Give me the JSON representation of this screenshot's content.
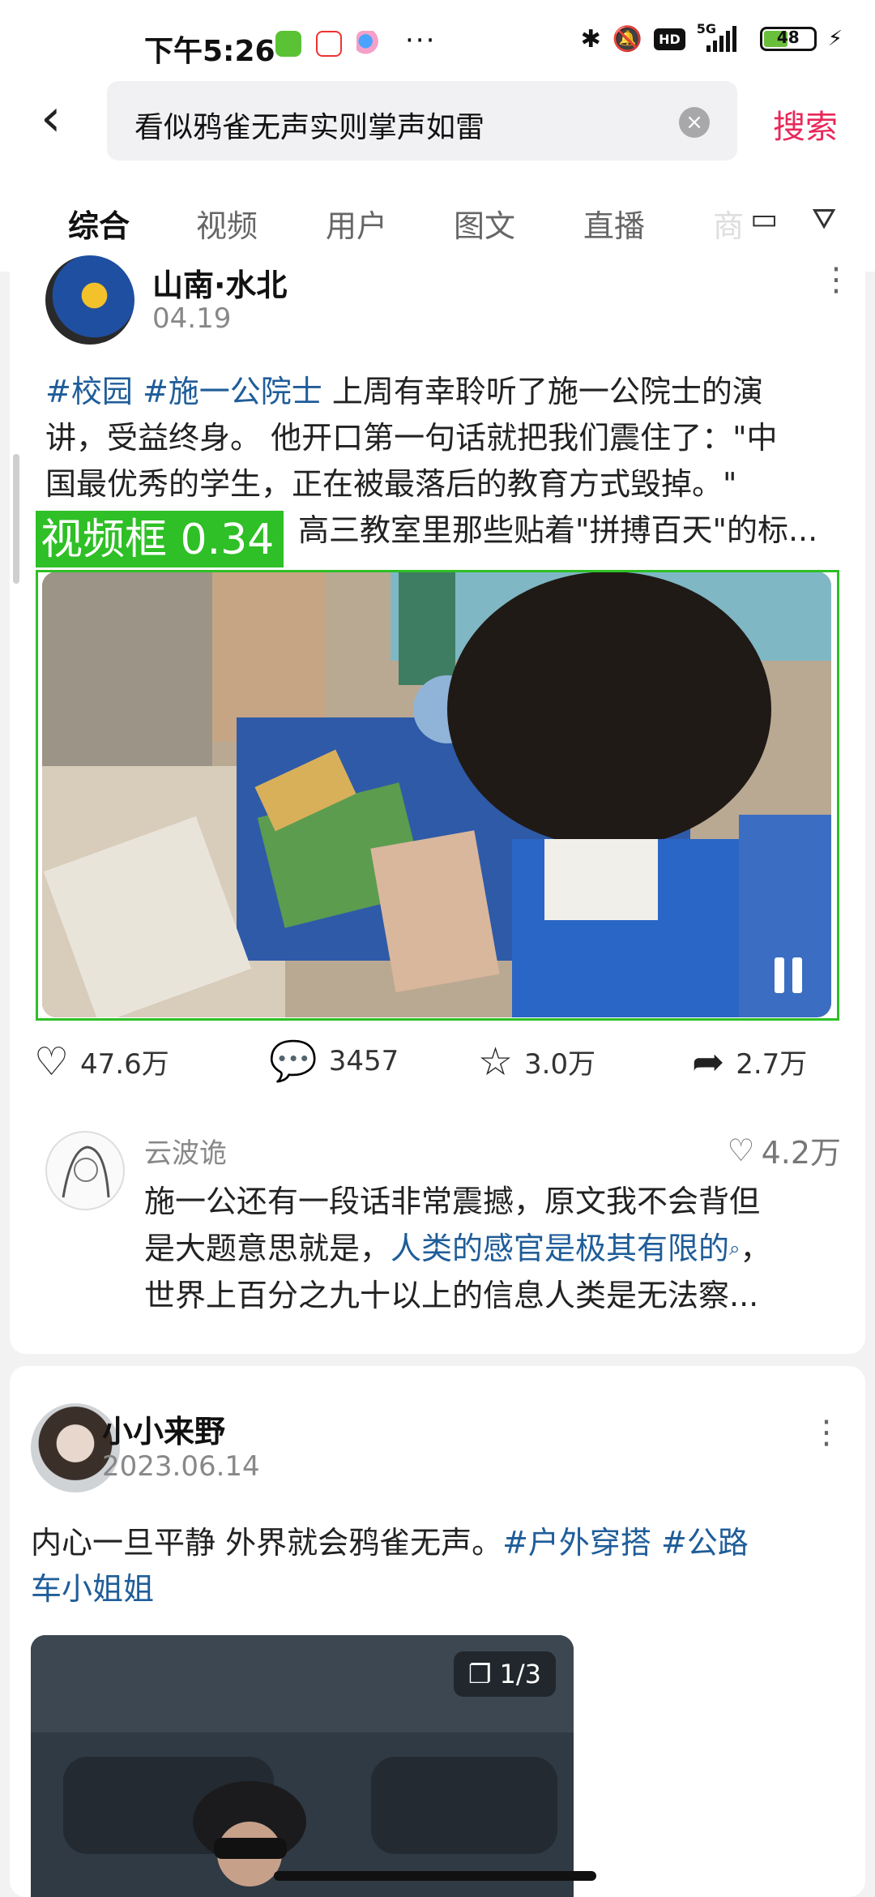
{
  "status_bar": {
    "time": "下午5:26",
    "network": "5G",
    "battery": "48",
    "battery_level": 0.48
  },
  "search": {
    "query": "看似鸦雀无声实则掌声如雷",
    "button": "搜索"
  },
  "tabs": [
    "综合",
    "视频",
    "用户",
    "图文",
    "直播",
    "商"
  ],
  "post1": {
    "author": "山南·水北",
    "date": "04.19",
    "tag1": "#校园",
    "tag2": "#施一公院士",
    "text_line1_rest": " 上周有幸聆听了施一公院士的演",
    "text_line2": "讲，受益终身。 他开口第一句话就把我们震住了：\"中",
    "text_line3": "国最优秀的学生，正在被最落后的教育方式毁掉。\"",
    "text_line4": "高三教室里那些贴着\"拼搏百天\"的标...",
    "detection_label": "视频框 0.34",
    "likes": "47.6万",
    "comments": "3457",
    "stars": "3.0万",
    "shares": "2.7万",
    "top_comment": {
      "user": "云波诡",
      "likes": "4.2万",
      "line1": "施一公还有一段话非常震撼，原文我不会背但",
      "line2_start": "是大题意思就是，",
      "line2_link": "人类的感官是极其有限的",
      "line2_end": "，",
      "line3": "世界上百分之九十以上的信息人类是无法察..."
    }
  },
  "post2": {
    "author": "小小来野",
    "date": "2023.06.14",
    "text_start": "内心一旦平静 外界就会鸦雀无声。",
    "tag1": "#户外穿搭",
    "tag2_part1": " #公路",
    "tag2_part2": "车小姐姐",
    "image_count": "1/3"
  },
  "colors": {
    "accent": "#e8285a",
    "tag": "#1f5d99",
    "detection": "#2fbf26"
  }
}
